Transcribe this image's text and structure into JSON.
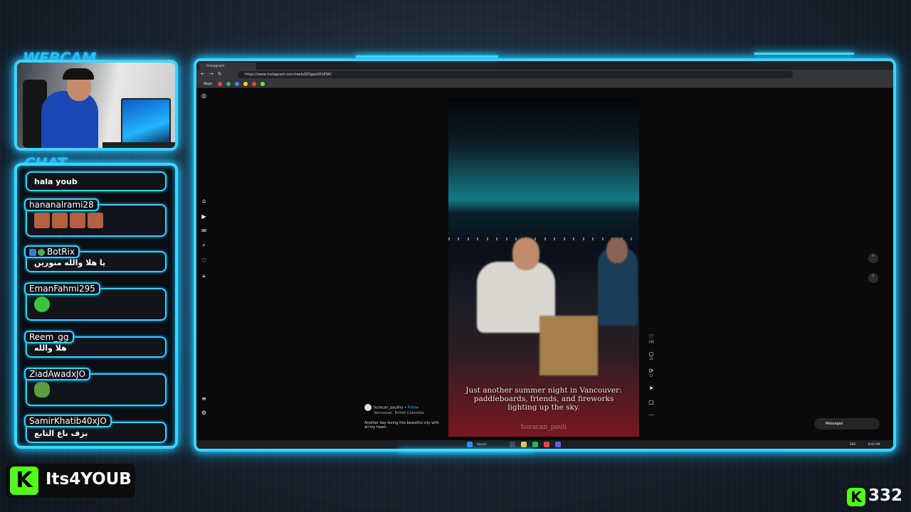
{
  "overlay": {
    "webcam_title": "WEBCAM",
    "chat_title": "CHAT",
    "streamer_name": "Its4YOUB",
    "kick_logo": "K",
    "viewer_count": "332",
    "accent_color": "#3fd3ff",
    "kick_color": "#53fc18"
  },
  "chat": {
    "messages": [
      {
        "user": "",
        "text": "hala youb"
      },
      {
        "user": "hananalrami28",
        "text": "",
        "emotes": [
          "emote-face",
          "emote-face",
          "emote-face"
        ]
      },
      {
        "user": "BotRix",
        "text": "يا هلا والله منورين",
        "badges": [
          "bot-badge",
          "verified-badge"
        ]
      },
      {
        "user": "EmanFahmi295",
        "text": "",
        "emotes": [
          "green-emote"
        ]
      },
      {
        "user": "Reem_gg",
        "text": "هلا والله"
      },
      {
        "user": "ZiadAwadxJO",
        "text": "",
        "emotes": [
          "pepe-emote"
        ]
      },
      {
        "user": "SamirKhatib40xJO",
        "text": "بزف ناع التابع"
      }
    ]
  },
  "browser": {
    "tab_title": "Instagram",
    "url": "https://www.instagram.com/reels/DOgqs0KhE9K/",
    "apps_label": "Apps"
  },
  "reel": {
    "caption": "Just another summer night in Vancouver: paddleboards, friends, and fireworks lighting up the sky.",
    "watermark": "huracan_pauli",
    "author": "huracan_paulina",
    "follow": "Follow",
    "location": "Vancouver, British Columbia",
    "description": "Another day loving this beautiful city with all my heart.",
    "likes": "146",
    "comments": "22",
    "shares": "17",
    "messages_label": "Messages"
  },
  "taskbar": {
    "search": "Search",
    "time": "8:40 AM",
    "lang": "ENG"
  }
}
